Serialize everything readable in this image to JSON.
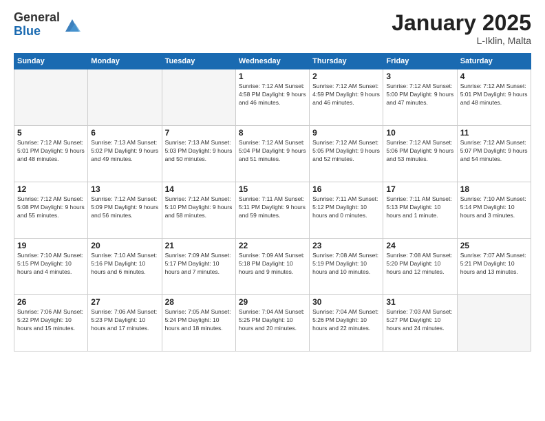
{
  "header": {
    "logo_general": "General",
    "logo_blue": "Blue",
    "month_title": "January 2025",
    "location": "L-Iklin, Malta"
  },
  "days_of_week": [
    "Sunday",
    "Monday",
    "Tuesday",
    "Wednesday",
    "Thursday",
    "Friday",
    "Saturday"
  ],
  "weeks": [
    [
      {
        "day": "",
        "info": ""
      },
      {
        "day": "",
        "info": ""
      },
      {
        "day": "",
        "info": ""
      },
      {
        "day": "1",
        "info": "Sunrise: 7:12 AM\nSunset: 4:58 PM\nDaylight: 9 hours and 46 minutes."
      },
      {
        "day": "2",
        "info": "Sunrise: 7:12 AM\nSunset: 4:59 PM\nDaylight: 9 hours and 46 minutes."
      },
      {
        "day": "3",
        "info": "Sunrise: 7:12 AM\nSunset: 5:00 PM\nDaylight: 9 hours and 47 minutes."
      },
      {
        "day": "4",
        "info": "Sunrise: 7:12 AM\nSunset: 5:01 PM\nDaylight: 9 hours and 48 minutes."
      }
    ],
    [
      {
        "day": "5",
        "info": "Sunrise: 7:12 AM\nSunset: 5:01 PM\nDaylight: 9 hours and 48 minutes."
      },
      {
        "day": "6",
        "info": "Sunrise: 7:13 AM\nSunset: 5:02 PM\nDaylight: 9 hours and 49 minutes."
      },
      {
        "day": "7",
        "info": "Sunrise: 7:13 AM\nSunset: 5:03 PM\nDaylight: 9 hours and 50 minutes."
      },
      {
        "day": "8",
        "info": "Sunrise: 7:12 AM\nSunset: 5:04 PM\nDaylight: 9 hours and 51 minutes."
      },
      {
        "day": "9",
        "info": "Sunrise: 7:12 AM\nSunset: 5:05 PM\nDaylight: 9 hours and 52 minutes."
      },
      {
        "day": "10",
        "info": "Sunrise: 7:12 AM\nSunset: 5:06 PM\nDaylight: 9 hours and 53 minutes."
      },
      {
        "day": "11",
        "info": "Sunrise: 7:12 AM\nSunset: 5:07 PM\nDaylight: 9 hours and 54 minutes."
      }
    ],
    [
      {
        "day": "12",
        "info": "Sunrise: 7:12 AM\nSunset: 5:08 PM\nDaylight: 9 hours and 55 minutes."
      },
      {
        "day": "13",
        "info": "Sunrise: 7:12 AM\nSunset: 5:09 PM\nDaylight: 9 hours and 56 minutes."
      },
      {
        "day": "14",
        "info": "Sunrise: 7:12 AM\nSunset: 5:10 PM\nDaylight: 9 hours and 58 minutes."
      },
      {
        "day": "15",
        "info": "Sunrise: 7:11 AM\nSunset: 5:11 PM\nDaylight: 9 hours and 59 minutes."
      },
      {
        "day": "16",
        "info": "Sunrise: 7:11 AM\nSunset: 5:12 PM\nDaylight: 10 hours and 0 minutes."
      },
      {
        "day": "17",
        "info": "Sunrise: 7:11 AM\nSunset: 5:13 PM\nDaylight: 10 hours and 1 minute."
      },
      {
        "day": "18",
        "info": "Sunrise: 7:10 AM\nSunset: 5:14 PM\nDaylight: 10 hours and 3 minutes."
      }
    ],
    [
      {
        "day": "19",
        "info": "Sunrise: 7:10 AM\nSunset: 5:15 PM\nDaylight: 10 hours and 4 minutes."
      },
      {
        "day": "20",
        "info": "Sunrise: 7:10 AM\nSunset: 5:16 PM\nDaylight: 10 hours and 6 minutes."
      },
      {
        "day": "21",
        "info": "Sunrise: 7:09 AM\nSunset: 5:17 PM\nDaylight: 10 hours and 7 minutes."
      },
      {
        "day": "22",
        "info": "Sunrise: 7:09 AM\nSunset: 5:18 PM\nDaylight: 10 hours and 9 minutes."
      },
      {
        "day": "23",
        "info": "Sunrise: 7:08 AM\nSunset: 5:19 PM\nDaylight: 10 hours and 10 minutes."
      },
      {
        "day": "24",
        "info": "Sunrise: 7:08 AM\nSunset: 5:20 PM\nDaylight: 10 hours and 12 minutes."
      },
      {
        "day": "25",
        "info": "Sunrise: 7:07 AM\nSunset: 5:21 PM\nDaylight: 10 hours and 13 minutes."
      }
    ],
    [
      {
        "day": "26",
        "info": "Sunrise: 7:06 AM\nSunset: 5:22 PM\nDaylight: 10 hours and 15 minutes."
      },
      {
        "day": "27",
        "info": "Sunrise: 7:06 AM\nSunset: 5:23 PM\nDaylight: 10 hours and 17 minutes."
      },
      {
        "day": "28",
        "info": "Sunrise: 7:05 AM\nSunset: 5:24 PM\nDaylight: 10 hours and 18 minutes."
      },
      {
        "day": "29",
        "info": "Sunrise: 7:04 AM\nSunset: 5:25 PM\nDaylight: 10 hours and 20 minutes."
      },
      {
        "day": "30",
        "info": "Sunrise: 7:04 AM\nSunset: 5:26 PM\nDaylight: 10 hours and 22 minutes."
      },
      {
        "day": "31",
        "info": "Sunrise: 7:03 AM\nSunset: 5:27 PM\nDaylight: 10 hours and 24 minutes."
      },
      {
        "day": "",
        "info": ""
      }
    ]
  ]
}
